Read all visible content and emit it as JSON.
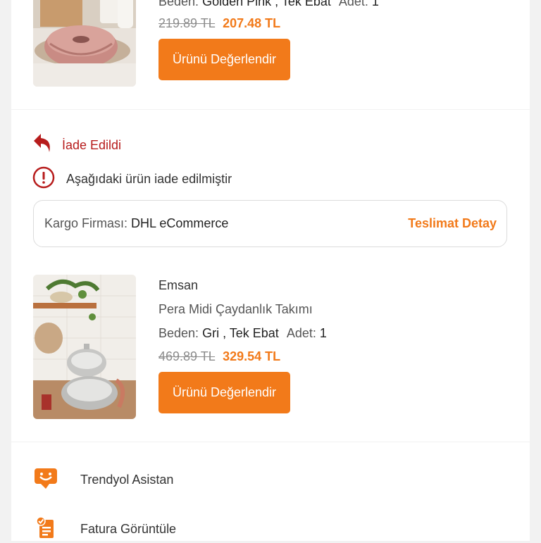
{
  "order_item_1": {
    "variant_label": "Beden:",
    "variant_value": "Golden Pink , Tek Ebat",
    "qty_label": "Adet:",
    "qty_value": "1",
    "price_old": "219.89 TL",
    "price_new": "207.48 TL",
    "rate_button": "Ürünü Değerlendir"
  },
  "returned_section": {
    "status": "İade Edildi",
    "info": "Aşağıdaki ürün iade edilmiştir",
    "cargo_label": "Kargo Firması:",
    "cargo_value": "DHL eCommerce",
    "delivery_link": "Teslimat Detay"
  },
  "order_item_2": {
    "brand": "Emsan",
    "name": "Pera Midi Çaydanlık Takımı",
    "variant_label": "Beden:",
    "variant_value": "Gri , Tek Ebat",
    "qty_label": "Adet:",
    "qty_value": "1",
    "price_old": "469.89 TL",
    "price_new": "329.54 TL",
    "rate_button": "Ürünü Değerlendir"
  },
  "menu": {
    "assistant": "Trendyol Asistan",
    "invoice": "Fatura Görüntüle"
  },
  "colors": {
    "accent": "#f27a1a",
    "return_red": "#b71c1c"
  },
  "icons": {
    "return": "return-arrow-icon",
    "info": "info-circle-icon",
    "assistant": "chat-smile-icon",
    "invoice": "document-check-icon"
  }
}
